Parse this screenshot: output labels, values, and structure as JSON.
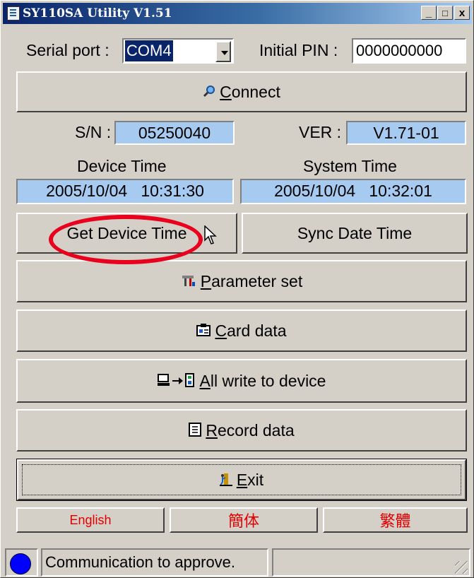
{
  "window": {
    "title": "SY110SA Utility V1.51"
  },
  "titlebar_buttons": {
    "minimize": "_",
    "maximize": "□",
    "close": "x"
  },
  "serial": {
    "label": "Serial port :",
    "value": "COM4"
  },
  "pin": {
    "label": "Initial PIN :",
    "value": "0000000000"
  },
  "connect": {
    "label": "Connect",
    "accel": "C",
    "rest": "onnect",
    "icon": "search-icon"
  },
  "sn": {
    "label": "S/N :",
    "value": "05250040"
  },
  "ver": {
    "label": "VER :",
    "value": "V1.71-01"
  },
  "device_time": {
    "label": "Device Time",
    "value": "2005/10/04   10:31:30"
  },
  "system_time": {
    "label": "System Time",
    "value": "2005/10/04   10:32:01"
  },
  "buttons": {
    "get_device_time": "Get Device Time",
    "sync_date_time": "Sync Date Time",
    "parameter_set": {
      "accel": "P",
      "rest": "arameter set",
      "icon": "tools-icon"
    },
    "card_data": {
      "accel": "C",
      "rest": "ard data",
      "icon": "card-icon"
    },
    "all_write": {
      "accel": "A",
      "rest": "ll write to device",
      "icon": "pc-to-device-icon"
    },
    "record_data": {
      "accel": "R",
      "rest": "ecord data",
      "icon": "document-icon"
    },
    "exit": {
      "accel": "E",
      "rest": "xit",
      "icon": "exit-door-icon"
    }
  },
  "languages": [
    "English",
    "簡体",
    "繁體"
  ],
  "status": {
    "message": "Communication to approve.",
    "indicator_color": "#0000ff"
  },
  "colors": {
    "title_bar": "#0a246a",
    "info_fill": "#a6caf0",
    "highlight_ellipse": "#e8001c",
    "language_text": "#e00000"
  }
}
